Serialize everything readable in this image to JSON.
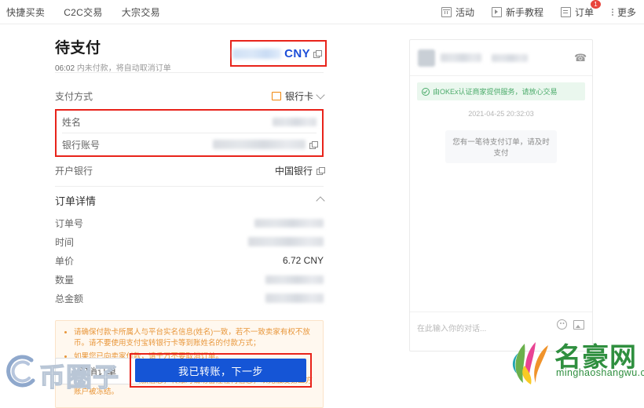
{
  "nav": {
    "left_items": [
      {
        "label": "快捷买卖"
      },
      {
        "label": "C2C交易"
      },
      {
        "label": "大宗交易"
      }
    ],
    "right_items": [
      {
        "label": "活动",
        "icon": "calendar-icon"
      },
      {
        "label": "新手教程",
        "icon": "video-tutorial-icon"
      },
      {
        "label": "订单",
        "icon": "order-doc-icon",
        "badge": "1"
      },
      {
        "label": "更多",
        "icon": "more-dots-icon"
      }
    ]
  },
  "order": {
    "status_title": "待支付",
    "countdown_time": "06:02",
    "countdown_suffix": "内未付款，将自动取消订单",
    "amount_currency": "CNY",
    "amount_value": "",
    "payment_method_label": "支付方式",
    "payment_method_value": "银行卡",
    "name_label": "姓名",
    "name_value": "",
    "bank_account_label": "银行账号",
    "bank_account_value": "",
    "bank_label": "开户银行",
    "bank_value": "中国银行",
    "details_title": "订单详情",
    "details": [
      {
        "label": "订单号",
        "value": "",
        "blurred": true
      },
      {
        "label": "时间",
        "value": "",
        "blurred": true
      },
      {
        "label": "单价",
        "value": "6.72 CNY",
        "blurred": false
      },
      {
        "label": "数量",
        "value": "",
        "blurred": true
      },
      {
        "label": "总金额",
        "value": "",
        "blurred": true
      }
    ],
    "warnings": [
      "请确保付款卡所属人与平台实名信息(姓名)一致，若不一致卖家有权不放币。请不要使用支付宝转银行卡等到账姓名的付款方式；",
      "如果您已向卖家付款，请千万不要取消订单。",
      "如需要根据对方的收款方式通过微信/支付宝/银行卡等平台转账给对方，请认真核对对方的收款信息，转账时请勿备注任何信息，以免触发第三方账户被冻结。"
    ],
    "cancel_label": "取消订单",
    "next_label": "我已转账，下一步"
  },
  "chat": {
    "merchant_name": "",
    "call_icon": "phone-icon",
    "system_banner": "由OKEx认证商家提供服务，请放心交易",
    "timestamp": "2021-04-25 20:32:03",
    "message": "您有一笔待支付订单，请及时支付",
    "input_placeholder": "在此输入你的对话...",
    "emoji_icon": "emoji-icon",
    "image_icon": "image-upload-icon"
  },
  "watermarks": {
    "left_text": "币圈子",
    "right_text": "名豪网",
    "right_sub": "minghaoshangwu.com"
  },
  "colors": {
    "accent_blue": "#1555d6",
    "highlight_red": "#e8231a",
    "warn_orange": "#e8963a",
    "success_green": "#4bab6a"
  }
}
